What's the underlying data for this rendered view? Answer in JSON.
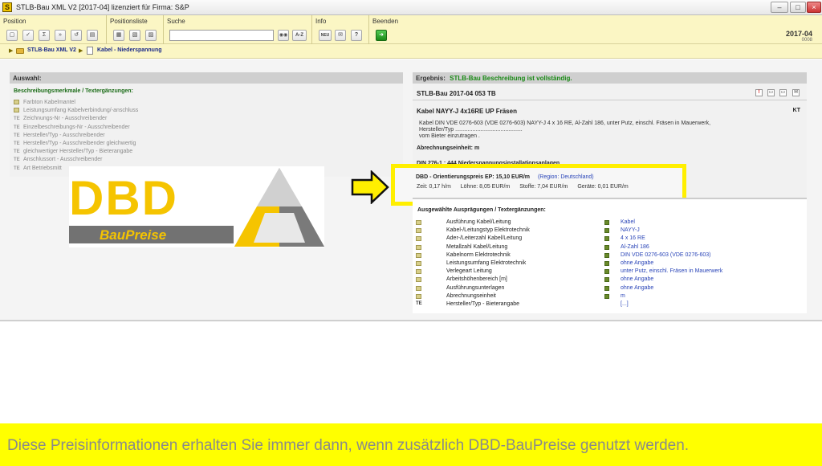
{
  "window": {
    "app_icon": "S",
    "title": "STLB-Bau XML V2 [2017-04] lizenziert für Firma: S&P",
    "min": "–",
    "max": "□",
    "close": "×"
  },
  "toolbar": {
    "groups": [
      "Position",
      "Positionsliste",
      "Suche",
      "Info",
      "Beenden"
    ],
    "search_placeholder": "",
    "search_btn": "🔭",
    "az_btn": "A-Z",
    "neu_btn": "NEU",
    "version_year": "2017-04",
    "version_code": "0008"
  },
  "breadcrumb": {
    "item1": "STLB-Bau XML V2",
    "item2": "Kabel - Niederspannung"
  },
  "left": {
    "header": "Auswahl:",
    "subheader": "Beschreibungsmerkmale / Textergänzungen:",
    "rows": [
      {
        "mark": "box",
        "text": "Farbton Kabelmantel"
      },
      {
        "mark": "box",
        "text": "Leistungsumfang Kabelverbindung/-anschluss"
      },
      {
        "mark": "TE",
        "text": "Zeichnungs-Nr - Ausschreibender"
      },
      {
        "mark": "TE",
        "text": "Einzelbeschreibungs-Nr - Ausschreibender"
      },
      {
        "mark": "TE",
        "text": "Hersteller/Typ - Ausschreibender"
      },
      {
        "mark": "TE",
        "text": "Hersteller/Typ - Ausschreibender gleichwertig"
      },
      {
        "mark": "TE",
        "text": "gleichwertiger Hersteller/Typ - Bieterangabe"
      },
      {
        "mark": "TE",
        "text": "Anschlussort - Ausschreibender"
      },
      {
        "mark": "TE",
        "text": "Art Betriebsmitt"
      }
    ]
  },
  "logo": {
    "dbd": "DBD",
    "baupreise": "BauPreise"
  },
  "right": {
    "header_label": "Ergebnis:",
    "header_status": "STLB-Bau Beschreibung ist vollständig.",
    "stlb_code": "STLB-Bau 2017-04 053 TB",
    "title": "Kabel NAYY-J 4x16RE UP Fräsen",
    "kt": "KT",
    "desc1": "Kabel DIN VDE 0276-603 (VDE 0276-603) NAYY-J 4 x 16 RE, Al-Zahl 186, unter Putz, einschl. Fräsen in Mauerwerk,",
    "desc2": "Hersteller/Typ ...........................................",
    "desc3": "vom Bieter einzutragen .",
    "abrechnung": "Abrechnungseinheit: m",
    "din_partial": "DIN 276-1 : 444 Niederspannungsinstallationsanlagen"
  },
  "price": {
    "label": "DBD - Orientierungspreis EP: 15,10 EUR/m",
    "region": "(Region: Deutschland)",
    "zeit": "Zeit: 0,17 h/m",
    "loehne": "Löhne: 8,05 EUR/m",
    "stoffe": "Stoffe: 7,04 EUR/m",
    "geraete": "Geräte: 0,01 EUR/m"
  },
  "auspraegungen": {
    "header": "Ausgewählte Ausprägungen / Textergänzungen:",
    "rows": [
      {
        "mark": "box",
        "name": "Ausführung Kabel/Leitung",
        "value": "Kabel"
      },
      {
        "mark": "box",
        "name": "Kabel-/Leitungstyp Elektrotechnik",
        "value": "NAYY-J"
      },
      {
        "mark": "box",
        "name": "Ader-/Leiterzahl Kabel/Leitung",
        "value": "4 x 16 RE"
      },
      {
        "mark": "box",
        "name": "Metallzahl Kabel/Leitung",
        "value": "Al-Zahl 186"
      },
      {
        "mark": "box",
        "name": "Kabelnorm Elektrotechnik",
        "value": "DIN VDE 0276-603 (VDE 0276-603)"
      },
      {
        "mark": "box",
        "name": "Leistungsumfang Elektrotechnik",
        "value": "ohne Angabe"
      },
      {
        "mark": "box",
        "name": "Verlegeart Leitung",
        "value": "unter Putz, einschl. Fräsen in Mauerwerk"
      },
      {
        "mark": "box",
        "name": "Arbeitshöhenbereich [m]",
        "value": "ohne Angabe"
      },
      {
        "mark": "box",
        "name": "Ausführungsunterlagen",
        "value": "ohne Angabe"
      },
      {
        "mark": "box",
        "name": "Abrechnungseinheit",
        "value": "m"
      },
      {
        "mark": "TE",
        "name": "Hersteller/Typ - Bieterangabe",
        "value": "[...]"
      }
    ]
  },
  "banner": {
    "text": "Diese Preisinformationen erhalten Sie immer dann, wenn zusätzlich DBD-BauPreise genutzt werden."
  },
  "colors": {
    "toolbar_bg": "#fbf6c4",
    "highlight": "#ffef00",
    "status_green": "#1a8a16",
    "link_blue": "#2a45b8"
  }
}
